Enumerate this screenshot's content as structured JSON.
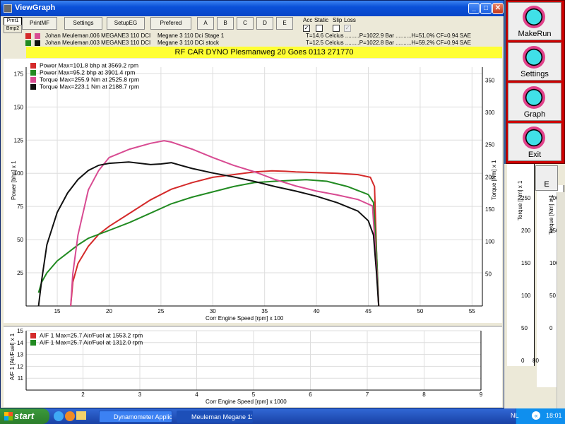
{
  "window": {
    "title": "ViewGraph",
    "small_buttons": [
      "Prnt1",
      "Bmp2"
    ],
    "toolbar": [
      "PrintMF",
      "Settings",
      "SetupEG",
      "Prefered",
      "A",
      "B",
      "C",
      "D",
      "E"
    ],
    "toggles": {
      "labels": [
        "Acc",
        "Static",
        "Slip",
        "Loss"
      ]
    },
    "runs": [
      {
        "name": "Johan Meuleman.006 MEGANE3 110 DCI",
        "desc": "Megane 3 110 Dci Stage 1",
        "cond": "T=14.6 Celcius .........P=1022.9 Bar ..........H=51.0% CF=0.94 SAE",
        "c1": "#d42a2a",
        "c2": "#d84b92"
      },
      {
        "name": "Johan Meuleman.003 MEGANE3 110 DCI",
        "desc": "Megane 3 110 DCi stock",
        "cond": "T=12.5 Celcius .........P=1022.8 Bar ..........H=59.2% CF=0.94 SAE",
        "c1": "#228b22",
        "c2": "#111111"
      }
    ],
    "banner": "RF CAR DYNO  Plesmanweg 20 Goes  0113 271770",
    "main_legend": [
      {
        "text": "Power  Max=101.8 bhp at 3569.2 rpm",
        "color": "#d42a2a"
      },
      {
        "text": "Power  Max=95.2 bhp at 3901.4 rpm",
        "color": "#228b22"
      },
      {
        "text": "Torque  Max=255.9 Nm at 2525.8 rpm",
        "color": "#d84b92"
      },
      {
        "text": "Torque  Max=223.1 Nm at 2188.7 rpm",
        "color": "#111111"
      }
    ],
    "af_legend": [
      {
        "text": "A/F 1  Max=25.7 Air/Fuel at 1553.2 rpm",
        "color": "#d42a2a"
      },
      {
        "text": "A/F 1  Max=25.7 Air/Fuel at 1312.0 rpm",
        "color": "#228b22"
      }
    ],
    "axis_labels": {
      "y_left": "Power [bhp] x 1",
      "y_right": "Torque [Nm] x 1",
      "x_main": "Corr Engine Speed [rpm] x 100",
      "y_af": "A/F 1 [Air/Fuel] x 1",
      "x_af": "Corr Engine Speed [rpm] x 1000"
    }
  },
  "chart_data": [
    {
      "type": "line",
      "xlabel": "Corr Engine Speed [rpm] x 100",
      "ylabel": "Power [bhp] x 1",
      "y2label": "Torque [Nm] x 1",
      "xlim": [
        12,
        56
      ],
      "ylim": [
        0,
        180
      ],
      "y2lim": [
        0,
        370
      ],
      "xticks": [
        15,
        20,
        25,
        30,
        35,
        40,
        45,
        50,
        55
      ],
      "yticks": [
        25,
        50,
        75,
        100,
        125,
        150,
        175
      ],
      "y2ticks": [
        50,
        100,
        150,
        200,
        250,
        300,
        350
      ],
      "grid": true,
      "legend": "top-left",
      "series": [
        {
          "name": "Power  Max=101.8 bhp at 3569.2 rpm",
          "axis": "left",
          "color": "#d42a2a",
          "x": [
            16.3,
            16.5,
            17,
            18,
            19,
            20,
            22,
            24,
            26,
            28,
            30,
            32,
            34,
            35.7,
            37,
            38,
            40,
            42,
            44,
            45.2,
            45.6,
            45.8,
            46.0
          ],
          "y": [
            0,
            18,
            32,
            45,
            54,
            60,
            70,
            80,
            88,
            93,
            97,
            99,
            101,
            101.8,
            101.5,
            101,
            100.5,
            100,
            99,
            97,
            90,
            40,
            0
          ]
        },
        {
          "name": "Power  Max=95.2 bhp at 3901.4 rpm",
          "axis": "left",
          "color": "#228b22",
          "x": [
            13.2,
            13.5,
            14,
            15,
            16,
            17,
            18,
            20,
            22,
            24,
            26,
            28,
            30,
            32,
            34,
            36,
            39,
            41,
            43,
            45,
            45.5,
            45.8,
            46
          ],
          "y": [
            10,
            18,
            25,
            34,
            40,
            46,
            51,
            57,
            63,
            70,
            77,
            82,
            86,
            90,
            93,
            94,
            95.2,
            94,
            90,
            84,
            78,
            40,
            0
          ]
        },
        {
          "name": "Torque  Max=255.9 Nm at 2525.8 rpm",
          "axis": "right",
          "color": "#d84b92",
          "x": [
            16.3,
            16.5,
            17,
            18,
            19,
            20,
            22,
            24,
            25.3,
            26,
            28,
            30,
            32,
            34,
            36,
            38,
            40,
            42,
            44,
            45.4,
            45.8,
            46
          ],
          "y": [
            0,
            50,
            110,
            180,
            210,
            230,
            243,
            252,
            255.9,
            254,
            243,
            230,
            218,
            208,
            196,
            186,
            178,
            172,
            165,
            155,
            60,
            0
          ]
        },
        {
          "name": "Torque  Max=223.1 Nm at 2188.7 rpm",
          "axis": "right",
          "color": "#111111",
          "x": [
            13.2,
            13.5,
            14,
            15,
            16,
            17,
            18,
            19,
            20,
            21.9,
            23,
            24,
            25,
            26,
            28,
            30,
            32,
            34,
            36,
            38,
            40,
            42,
            44,
            45,
            45.5,
            45.8,
            46
          ],
          "y": [
            0,
            40,
            95,
            145,
            175,
            196,
            210,
            218,
            221,
            223.1,
            221,
            219,
            220,
            222,
            213,
            206,
            200,
            193,
            185,
            178,
            170,
            160,
            147,
            132,
            110,
            50,
            0
          ]
        }
      ]
    },
    {
      "type": "line",
      "xlabel": "Corr Engine Speed [rpm] x 1000",
      "ylabel": "A/F 1 [Air/Fuel] x 1",
      "xlim": [
        1,
        9
      ],
      "ylim": [
        10,
        15
      ],
      "xticks": [
        2,
        3,
        4,
        5,
        6,
        7,
        8,
        9
      ],
      "yticks": [
        11,
        12,
        13,
        14,
        15
      ],
      "grid": true,
      "legend": "top-left",
      "series": [
        {
          "name": "A/F 1  Max=25.7 Air/Fuel at 1553.2 rpm",
          "color": "#d42a2a",
          "x": [],
          "y": []
        },
        {
          "name": "A/F 1  Max=25.7 Air/Fuel at 1312.0 rpm",
          "color": "#228b22",
          "x": [],
          "y": []
        }
      ]
    }
  ],
  "background_window": {
    "y_label": "Torque [Nm] x 1",
    "y_label2": "Torque [Nm] x 1",
    "ticks": [
      "250",
      "200",
      "150",
      "100",
      "50",
      "0"
    ],
    "ticks2": [
      "200",
      "150",
      "100",
      "50",
      "0"
    ],
    "partial_button": "E",
    "x_tick": "80"
  },
  "panel": {
    "buttons": [
      "MakeRun",
      "Settings",
      "Graph",
      "Exit"
    ]
  },
  "taskbar": {
    "start": "start",
    "tasks": [
      "Dynamometer Applica...",
      "Meuleman Megane 11..."
    ],
    "lang": "NL",
    "clock": "18:01"
  }
}
